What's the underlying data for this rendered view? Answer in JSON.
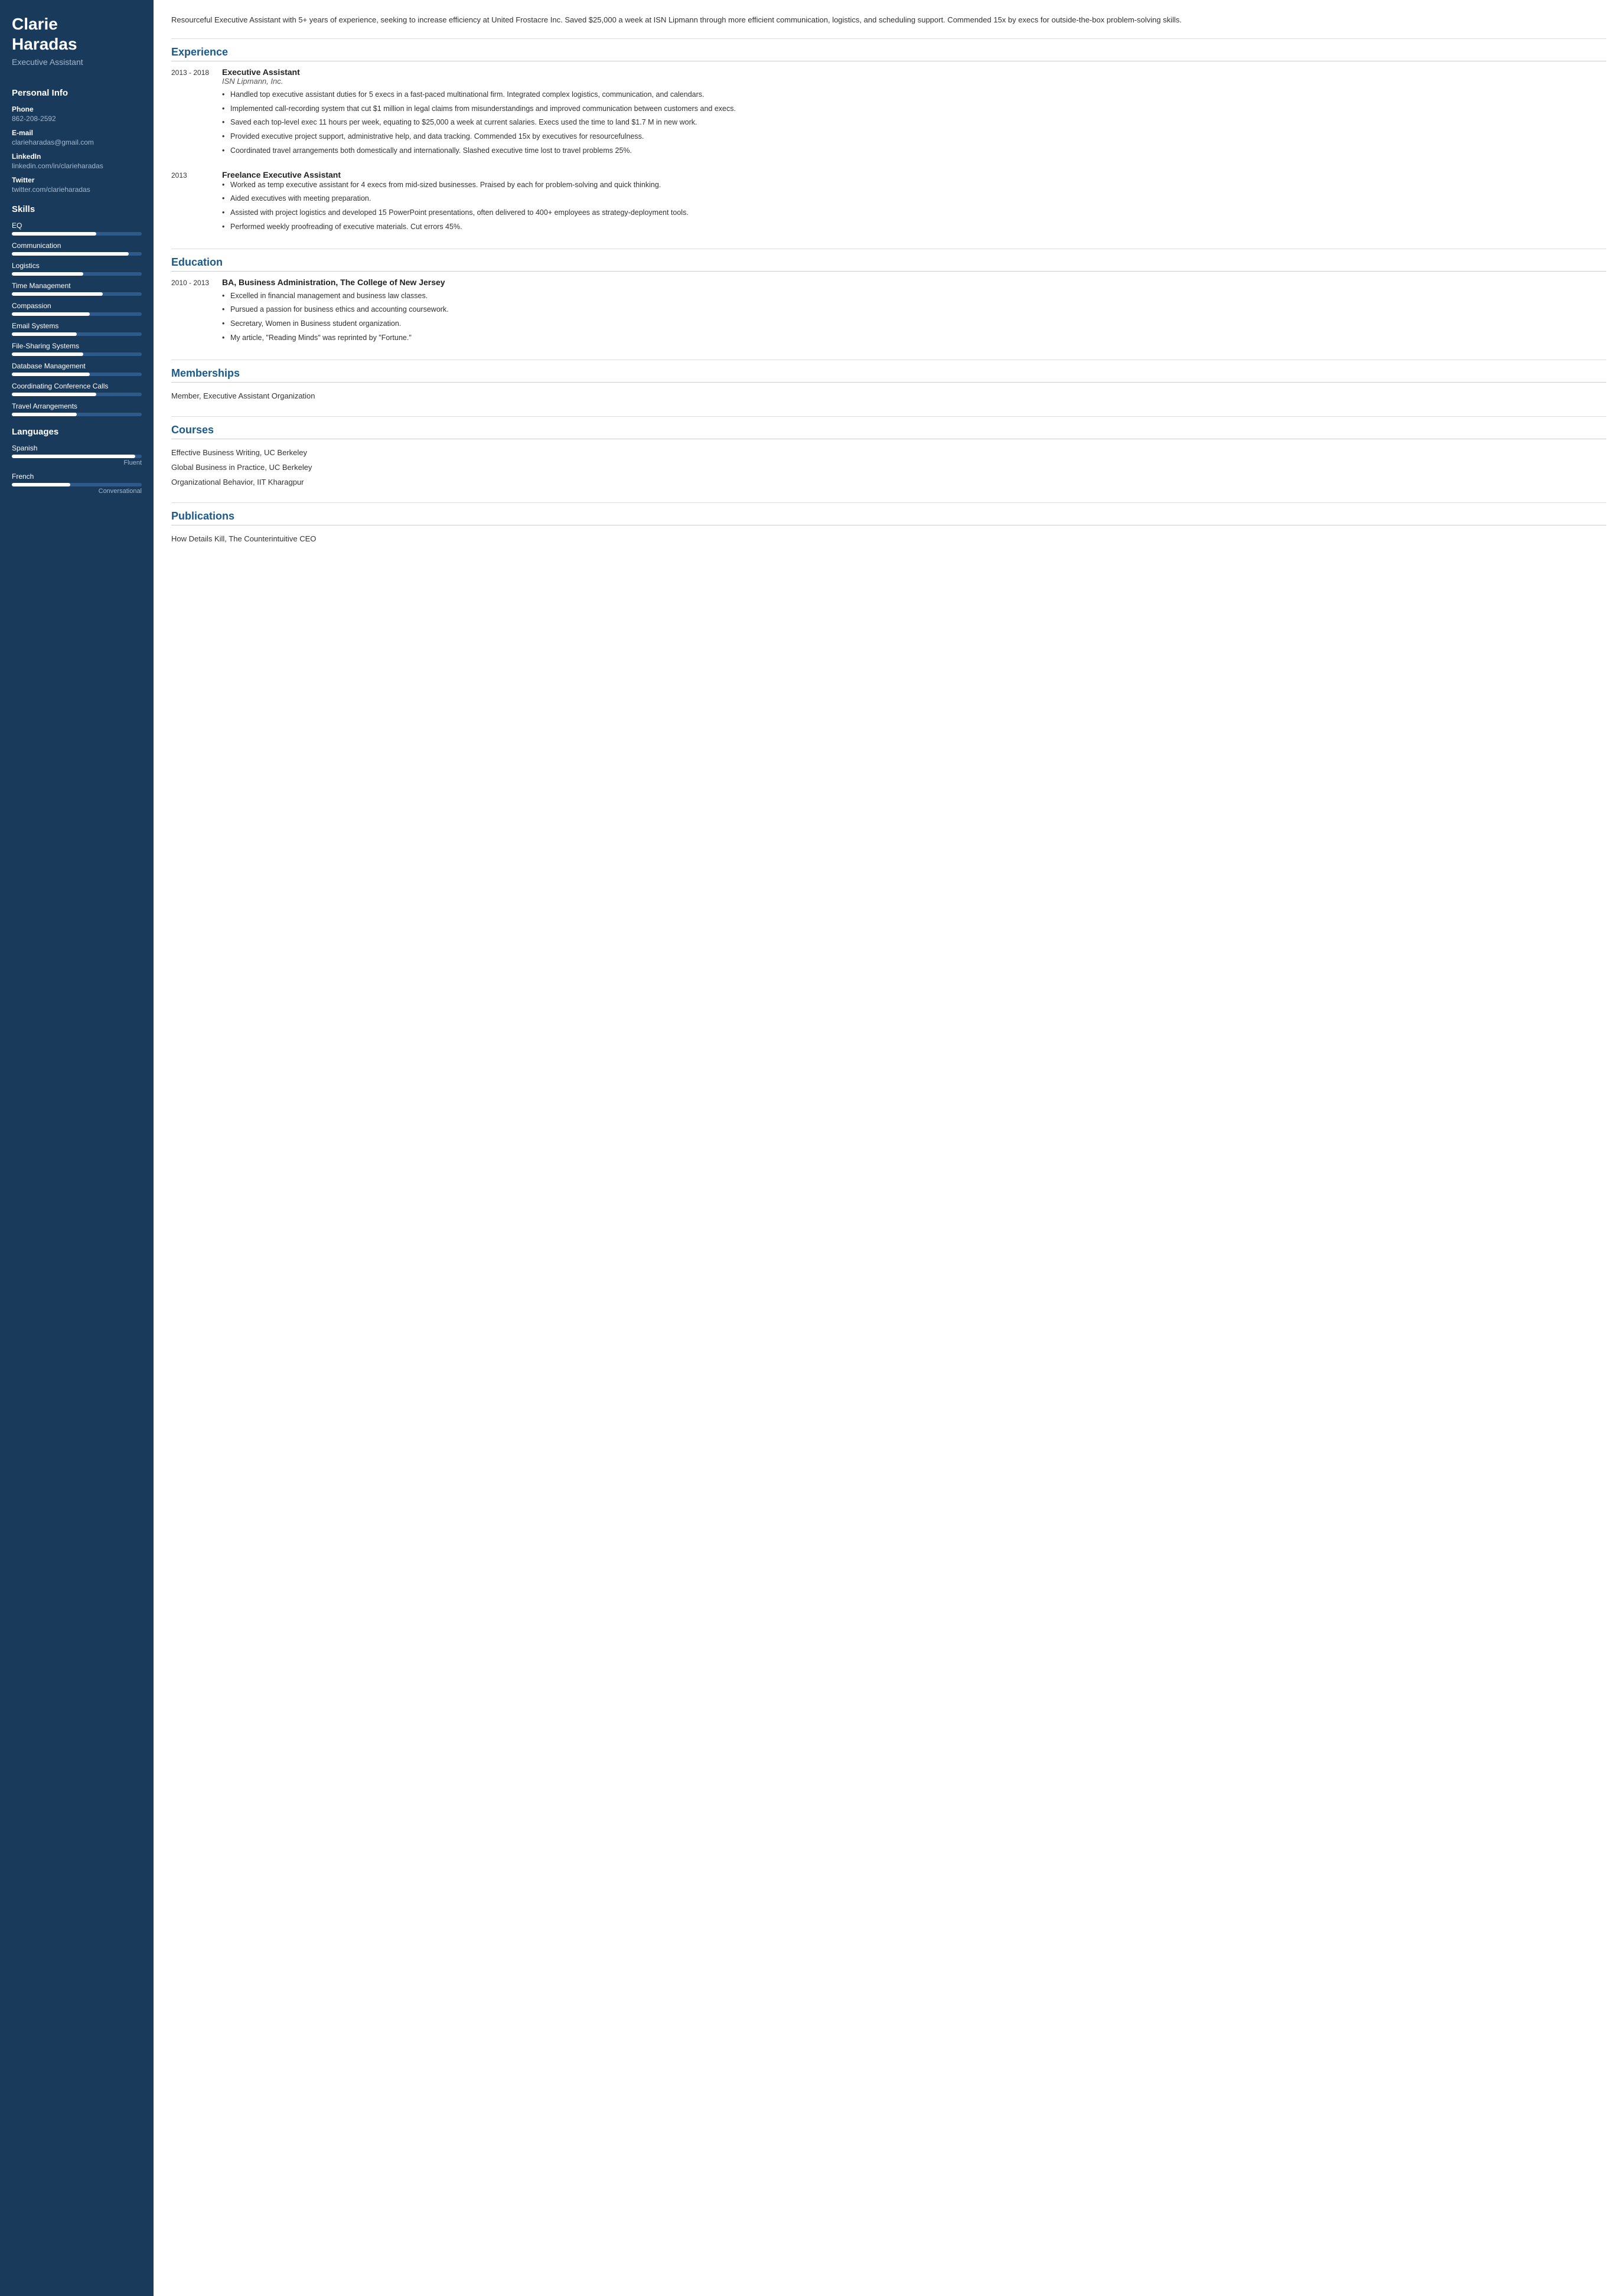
{
  "sidebar": {
    "name": "Clarie\nHaradas",
    "name_line1": "Clarie",
    "name_line2": "Haradas",
    "title": "Executive Assistant",
    "personal_info": {
      "section_title": "Personal Info",
      "phone_label": "Phone",
      "phone": "862-208-2592",
      "email_label": "E-mail",
      "email": "clarieharadas@gmail.com",
      "linkedin_label": "LinkedIn",
      "linkedin": "linkedin.com/in/clarieharadas",
      "twitter_label": "Twitter",
      "twitter": "twitter.com/clarieharadas"
    },
    "skills": {
      "section_title": "Skills",
      "items": [
        {
          "name": "EQ",
          "pct": 65
        },
        {
          "name": "Communication",
          "pct": 90
        },
        {
          "name": "Logistics",
          "pct": 55
        },
        {
          "name": "Time Management",
          "pct": 70
        },
        {
          "name": "Compassion",
          "pct": 60
        },
        {
          "name": "Email Systems",
          "pct": 50
        },
        {
          "name": "File-Sharing Systems",
          "pct": 55
        },
        {
          "name": "Database Management",
          "pct": 60
        },
        {
          "name": "Coordinating Conference Calls",
          "pct": 65
        },
        {
          "name": "Travel Arrangements",
          "pct": 50
        }
      ]
    },
    "languages": {
      "section_title": "Languages",
      "items": [
        {
          "name": "Spanish",
          "pct": 95,
          "level": "Fluent"
        },
        {
          "name": "French",
          "pct": 45,
          "level": "Conversational"
        }
      ]
    }
  },
  "main": {
    "summary": "Resourceful Executive Assistant with 5+ years of experience, seeking to increase efficiency at United Frostacre Inc. Saved $25,000 a week at ISN Lipmann through more efficient communication, logistics, and scheduling support. Commended 15x by execs for outside-the-box problem-solving skills.",
    "sections": {
      "experience": {
        "title": "Experience",
        "jobs": [
          {
            "dates": "2013 - 2018",
            "title": "Executive Assistant",
            "company": "ISN Lipmann, Inc.",
            "bullets": [
              "Handled top executive assistant duties for 5 execs in a fast-paced multinational firm. Integrated complex logistics, communication, and calendars.",
              "Implemented call-recording system that cut $1 million in legal claims from misunderstandings and improved communication between customers and execs.",
              "Saved each top-level exec 11 hours per week, equating to $25,000 a week at current salaries. Execs used the time to land $1.7 M in new work.",
              "Provided executive project support, administrative help, and data tracking. Commended 15x by executives for resourcefulness.",
              "Coordinated travel arrangements both domestically and internationally. Slashed executive time lost to travel problems 25%."
            ]
          },
          {
            "dates": "2013",
            "title": "Freelance Executive Assistant",
            "company": "",
            "bullets": [
              "Worked as temp executive assistant for 4 execs from mid-sized businesses. Praised by each for problem-solving and quick thinking.",
              "Aided executives with meeting preparation.",
              "Assisted with project logistics and developed 15 PowerPoint presentations, often delivered to 400+ employees as strategy-deployment tools.",
              "Performed weekly proofreading of executive materials. Cut errors 45%."
            ]
          }
        ]
      },
      "education": {
        "title": "Education",
        "items": [
          {
            "dates": "2010 - 2013",
            "degree": "BA, Business Administration, The College of New Jersey",
            "bullets": [
              "Excelled in financial management and business law classes.",
              "Pursued a passion for business ethics and accounting coursework.",
              "Secretary, Women in Business student organization.",
              "My article, \"Reading Minds\" was reprinted by \"Fortune.\""
            ]
          }
        ]
      },
      "memberships": {
        "title": "Memberships",
        "items": [
          "Member, Executive Assistant Organization"
        ]
      },
      "courses": {
        "title": "Courses",
        "items": [
          "Effective Business Writing, UC Berkeley",
          "Global Business in Practice, UC Berkeley",
          "Organizational Behavior, IIT Kharagpur"
        ]
      },
      "publications": {
        "title": "Publications",
        "items": [
          "How Details Kill, The Counterintuitive CEO"
        ]
      }
    }
  }
}
